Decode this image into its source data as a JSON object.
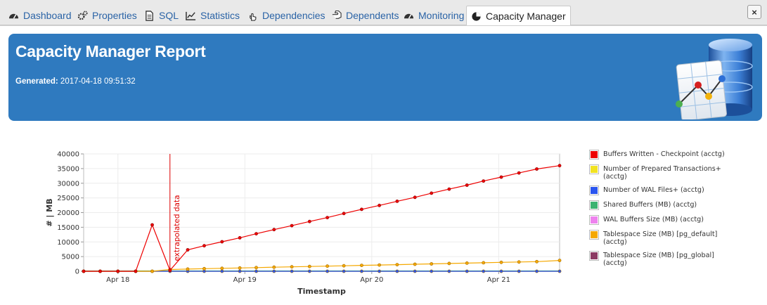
{
  "tabs": [
    {
      "label": "Dashboard",
      "icon": "dashboard-icon"
    },
    {
      "label": "Properties",
      "icon": "properties-cogs-icon"
    },
    {
      "label": "SQL",
      "icon": "sql-document-icon"
    },
    {
      "label": "Statistics",
      "icon": "statistics-line-chart-icon"
    },
    {
      "label": "Dependencies",
      "icon": "dependencies-hand-icon"
    },
    {
      "label": "Dependents",
      "icon": "dependents-hand-icon"
    },
    {
      "label": "Monitoring",
      "icon": "monitoring-dashboard-icon"
    },
    {
      "label": "Capacity Manager",
      "icon": "capacity-pie-chart-icon",
      "active": true
    }
  ],
  "close_button": {
    "label": "×"
  },
  "report": {
    "title": "Capacity Manager Report",
    "generated_label": "Generated:",
    "generated_value": "2017-04-18 09:51:32"
  },
  "colors": {
    "tab_link": "#2a63a6",
    "header_bg": "#2f7abf"
  },
  "chart_data": {
    "type": "line",
    "xlabel": "Timestamp",
    "ylabel": "# | MB",
    "ylim": [
      0,
      40000
    ],
    "yticks": [
      0,
      5000,
      10000,
      15000,
      20000,
      25000,
      30000,
      35000,
      40000
    ],
    "xlim": [
      -0.27,
      3.48
    ],
    "xticks": [
      {
        "label": "Apr 18",
        "value": 0
      },
      {
        "label": "Apr 19",
        "value": 1
      },
      {
        "label": "Apr 20",
        "value": 2
      },
      {
        "label": "Apr 21",
        "value": 3
      }
    ],
    "grid": true,
    "legend_position": "right",
    "annotation": {
      "label": "extrapolated data",
      "x": 0.41
    },
    "series": [
      {
        "name": "Buffers Written - Checkpoint (acctg)",
        "color": "#ee0000",
        "x": [
          -0.27,
          -0.14,
          0.0,
          0.14,
          0.27,
          0.41,
          0.55,
          0.68,
          0.82,
          0.96,
          1.09,
          1.23,
          1.37,
          1.51,
          1.65,
          1.78,
          1.92,
          2.06,
          2.2,
          2.34,
          2.47,
          2.61,
          2.75,
          2.88,
          3.02,
          3.16,
          3.3,
          3.48
        ],
        "values": [
          0,
          0,
          0,
          0,
          15800,
          300,
          7300,
          8700,
          10050,
          11400,
          12800,
          14200,
          15550,
          16950,
          18300,
          19700,
          21100,
          22450,
          23850,
          25200,
          26600,
          28000,
          29350,
          30750,
          32100,
          33500,
          34850,
          36000
        ]
      },
      {
        "name": "Number of Prepared Transactions+ (acctg)",
        "color": "#f2e322",
        "x": [
          -0.27,
          3.48
        ],
        "values": [
          0,
          0
        ]
      },
      {
        "name": "Number of WAL Files+ (acctg)",
        "color": "#2a55f0",
        "x": [
          -0.27,
          -0.14,
          0.0,
          0.14,
          0.27,
          0.41,
          0.55,
          0.68,
          0.82,
          0.96,
          1.09,
          1.23,
          1.37,
          1.51,
          1.65,
          1.78,
          1.92,
          2.06,
          2.2,
          2.34,
          2.47,
          2.61,
          2.75,
          2.88,
          3.02,
          3.16,
          3.3,
          3.48
        ],
        "values": [
          0,
          0,
          0,
          0,
          0,
          0,
          0,
          0,
          0,
          0,
          0,
          0,
          0,
          0,
          0,
          0,
          0,
          0,
          0,
          0,
          0,
          0,
          0,
          0,
          0,
          0,
          0,
          0
        ]
      },
      {
        "name": "Shared Buffers (MB) (acctg)",
        "color": "#3cb371",
        "x": [
          -0.27,
          3.48
        ],
        "values": [
          128,
          128
        ]
      },
      {
        "name": "WAL Buffers Size (MB) (acctg)",
        "color": "#ee82ee",
        "x": [
          -0.27,
          3.48
        ],
        "values": [
          4,
          4
        ]
      },
      {
        "name": "Tablespace Size (MB) [pg_default] (acctg)",
        "color": "#f5a800",
        "x": [
          -0.27,
          -0.14,
          0.0,
          0.14,
          0.27,
          0.41,
          0.55,
          0.68,
          0.82,
          0.96,
          1.09,
          1.23,
          1.37,
          1.51,
          1.65,
          1.78,
          1.92,
          2.06,
          2.2,
          2.34,
          2.47,
          2.61,
          2.75,
          2.88,
          3.02,
          3.16,
          3.3,
          3.48
        ],
        "values": [
          0,
          0,
          0,
          0,
          0,
          600,
          750,
          880,
          1000,
          1120,
          1250,
          1380,
          1500,
          1630,
          1760,
          1880,
          2010,
          2140,
          2260,
          2390,
          2520,
          2650,
          2780,
          2900,
          3030,
          3160,
          3290,
          3700
        ]
      },
      {
        "name": "Tablespace Size (MB) [pg_global] (acctg)",
        "color": "#8b3a62",
        "x": [
          -0.27,
          3.48
        ],
        "values": [
          1,
          1
        ]
      }
    ]
  }
}
